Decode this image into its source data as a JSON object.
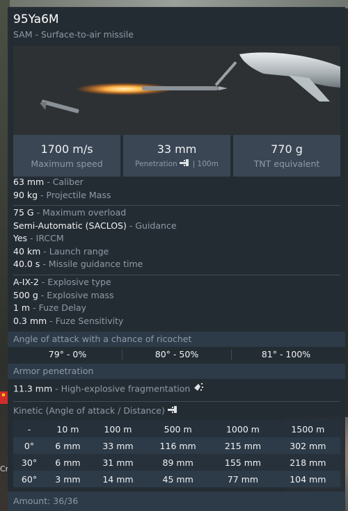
{
  "header": {
    "title": "95Ya6M",
    "subtitle": "SAM - Surface-to-air missile"
  },
  "stats": [
    {
      "value": "1700 m/s",
      "label": "Maximum speed"
    },
    {
      "value": "33 mm",
      "label": "Penetration",
      "suffix": "| 100m",
      "icon": "armor-icon"
    },
    {
      "value": "770 g",
      "label": "TNT equivalent"
    }
  ],
  "properties": {
    "group1": [
      {
        "value": "63 mm",
        "label": "- Caliber"
      },
      {
        "value": "90 kg",
        "label": "- Projectile Mass"
      }
    ],
    "group2": [
      {
        "value": "75 G",
        "label": "- Maximum overload"
      },
      {
        "value": "Semi-Automatic (SACLOS)",
        "label": "- Guidance"
      },
      {
        "value": "Yes",
        "label": "- IRCCM"
      },
      {
        "value": "40 km",
        "label": "- Launch range"
      },
      {
        "value": "40.0 s",
        "label": "- Missile guidance time"
      }
    ],
    "group3": [
      {
        "value": "A-IX-2",
        "label": "- Explosive type"
      },
      {
        "value": "500 g",
        "label": "- Explosive mass"
      },
      {
        "value": "1 m",
        "label": "- Fuze Delay"
      },
      {
        "value": "0.3 mm",
        "label": "- Fuze Sensitivity"
      }
    ]
  },
  "ricochet": {
    "heading": "Angle of attack with a chance of ricochet",
    "values": [
      "79° - 0%",
      "80° - 50%",
      "81° - 100%"
    ]
  },
  "armor_penetration": {
    "heading": "Armor penetration",
    "value": "11.3 mm",
    "label": "- High-explosive fragmentation",
    "icon": "fragmentation-icon"
  },
  "kinetic": {
    "heading": "Kinetic (Angle of attack / Distance)",
    "icon": "armor-icon",
    "columns": [
      "-",
      "10 m",
      "100 m",
      "500 m",
      "1000 m",
      "1500 m"
    ],
    "rows": [
      {
        "angle": "0°",
        "values": [
          "6 mm",
          "33 mm",
          "116 mm",
          "215 mm",
          "302 mm"
        ]
      },
      {
        "angle": "30°",
        "values": [
          "6 mm",
          "31 mm",
          "89 mm",
          "155 mm",
          "218 mm"
        ]
      },
      {
        "angle": "60°",
        "values": [
          "3 mm",
          "14 mm",
          "45 mm",
          "77 mm",
          "104 mm"
        ]
      }
    ]
  },
  "footer": {
    "amount": "Amount: 36/36"
  },
  "background": {
    "cr_text": "Cr"
  },
  "colors": {
    "panel_bg": "#242c34",
    "stat_bg": "#3a4654",
    "label_gray": "#8f9aa6",
    "value_white": "#f1f3f5"
  }
}
